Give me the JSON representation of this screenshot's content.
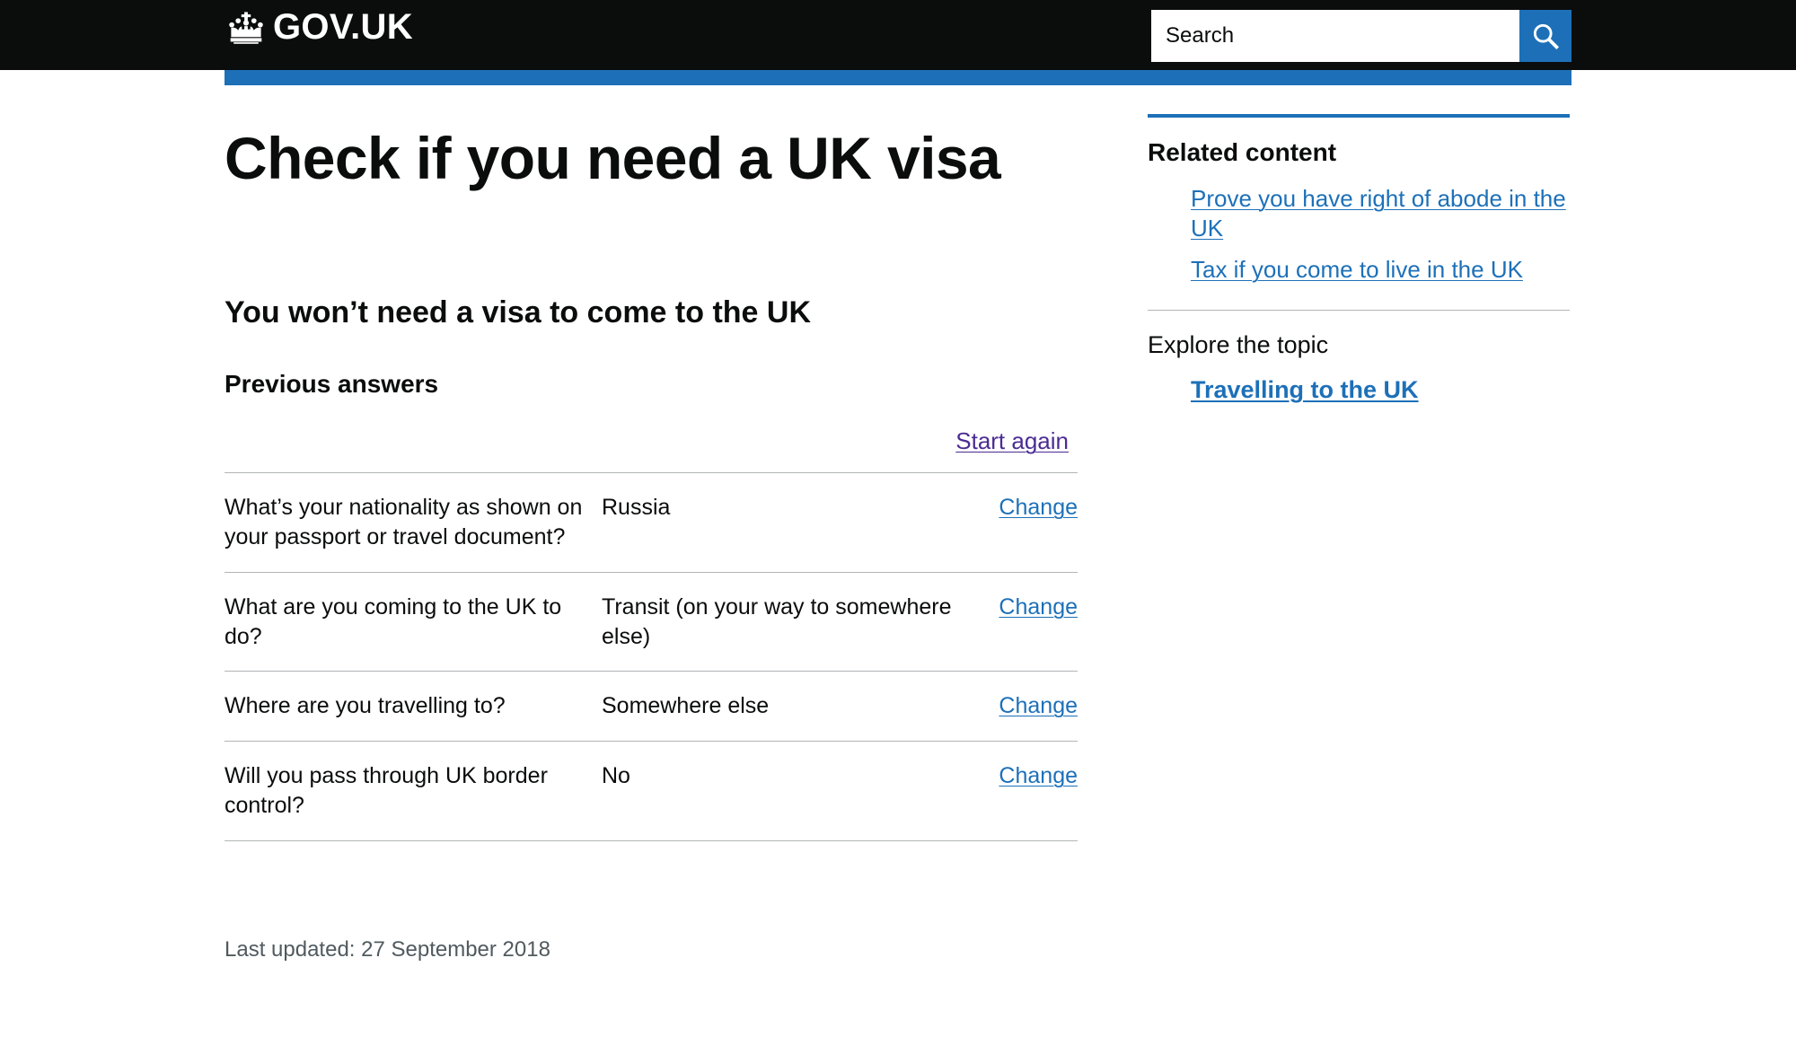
{
  "header": {
    "logo_text": "GOV.UK",
    "crown_icon": "crown-icon",
    "search": {
      "placeholder": "Search",
      "value": "",
      "button_icon": "search-icon"
    },
    "colors": {
      "bar_background": "#0b0c0c",
      "accent_blue": "#1d70b8",
      "link_blue": "#1d70b8",
      "link_visited": "#4c2c92",
      "muted_text": "#505a5f",
      "rule_grey": "#b1b4b6"
    }
  },
  "main": {
    "page_title": "Check if you need a UK visa",
    "result_heading": "You won’t need a visa to come to the UK",
    "previous_answers_heading": "Previous answers",
    "start_again_label": "Start again",
    "change_label": "Change",
    "answers": [
      {
        "question": "What’s your nationality as shown on your passport or travel document?",
        "answer": "Russia",
        "change": "Change"
      },
      {
        "question": "What are you coming to the UK to do?",
        "answer": "Transit (on your way to somewhere else)",
        "change": "Change"
      },
      {
        "question": "Where are you travelling to?",
        "answer": "Somewhere else",
        "change": "Change"
      },
      {
        "question": "Will you pass through UK border control?",
        "answer": "No",
        "change": "Change"
      }
    ],
    "last_updated": "Last updated: 27 September 2018"
  },
  "sidebar": {
    "related_content_title": "Related content",
    "related_links": [
      "Prove you have right of abode in the UK",
      "Tax if you come to live in the UK"
    ],
    "explore_title": "Explore the topic",
    "explore_links": [
      "Travelling to the UK"
    ]
  }
}
